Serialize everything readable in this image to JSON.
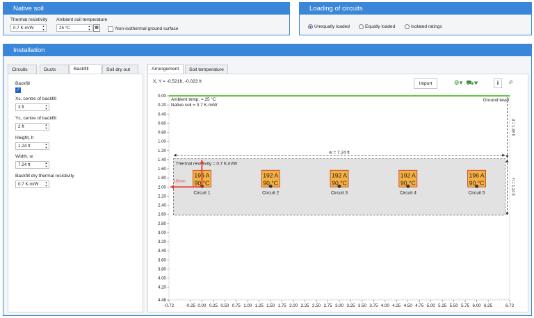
{
  "native_soil": {
    "title": "Native soil",
    "thermal_resistivity_label": "Thermal resistivity",
    "thermal_resistivity_value": "0.7 K.m/W",
    "ambient_temp_label": "Ambient soil temperature",
    "ambient_temp_value": "25 °C",
    "nonisothermal_label": "Non-isothermal ground surface",
    "nonisothermal_checked": false
  },
  "loading": {
    "title": "Loading of circuits",
    "options": [
      {
        "label": "Unequally loaded",
        "selected": true
      },
      {
        "label": "Equally loaded",
        "selected": false
      },
      {
        "label": "Isolated ratings",
        "selected": false
      }
    ]
  },
  "installation": {
    "title": "Installation",
    "left_tabs": [
      "Circuits",
      "Ducts",
      "Backfill",
      "Soil dry out"
    ],
    "left_active_tab": "Backfill",
    "backfill": {
      "backfill_label": "Backfill",
      "backfill_checked": true,
      "xc_label": "Xc, centre of backfill",
      "xc_value": "3 ft",
      "yc_label": "Yc, centre of backfill",
      "yc_value": "2 ft",
      "height_label": "Height, h",
      "height_value": "1.24 ft",
      "width_label": "Width, w",
      "width_value": "7.24 ft",
      "dry_label": "Backfill dry thermal resistivity",
      "dry_value": "0.7 K.m/W"
    },
    "right_tabs": [
      "Arrangement",
      "Soil temperature"
    ],
    "right_active_tab": "Arrangement",
    "coord_readout": "X, Y = -0.521ft, -0.023 ft",
    "import_label": "Import",
    "icons": [
      "cable-config-icon",
      "vehicle-config-icon",
      "info-icon",
      "zoom-icon"
    ]
  },
  "diagram": {
    "ground_level_label": "Ground level",
    "ambient_text": "Ambient temp. = 25 °C",
    "native_text": "Native soil = 0.7 K.m/W",
    "backfill_resistivity_text": "Thermal resistivity = 0.7 K.m/W",
    "width_dim_label": "w = 7.24 ft",
    "offset_label": "150mm",
    "right_dim_top": "d = 1.38 ft",
    "right_dim_bottom": "h = 1.24 ft",
    "circuits": [
      {
        "name": "Circuit 1",
        "current": "196 A",
        "temp": "90 °C",
        "x": 0.0
      },
      {
        "name": "Circuit 2",
        "current": "192 A",
        "temp": "90 °C",
        "x": 1.5
      },
      {
        "name": "Circuit 3",
        "current": "192 A",
        "temp": "90 °C",
        "x": 3.0
      },
      {
        "name": "Circuit 4",
        "current": "192 A",
        "temp": "90 °C",
        "x": 4.5
      },
      {
        "name": "Circuit 5",
        "current": "196 A",
        "temp": "90 °C",
        "x": 6.0
      }
    ],
    "circuit_depth": 2.0,
    "backfill_x": [
      -0.62,
      6.62
    ],
    "backfill_y": [
      1.38,
      2.62
    ],
    "x_ticks": [
      "-0.72",
      "-0.25",
      "0.00",
      "0.25",
      "0.50",
      "0.75",
      "1.00",
      "1.25",
      "1.50",
      "1.75",
      "2.00",
      "2.25",
      "2.50",
      "2.75",
      "3.00",
      "3.25",
      "3.50",
      "3.75",
      "4.00",
      "4.25",
      "4.50",
      "4.75",
      "5.00",
      "5.25",
      "5.50",
      "5.75",
      "6.00",
      "6.25",
      "6.72"
    ],
    "y_ticks": [
      "0.00",
      "0.20",
      "0.40",
      "0.60",
      "0.80",
      "1.00",
      "1.20",
      "1.40",
      "1.60",
      "1.80",
      "2.00",
      "2.20",
      "2.40",
      "2.60",
      "2.80",
      "3.00",
      "3.20",
      "3.40",
      "3.60",
      "3.80",
      "4.00",
      "4.20",
      "4.48"
    ],
    "x_range": [
      -0.72,
      6.72
    ],
    "y_range": [
      0.0,
      4.48
    ],
    "colors": {
      "accent": "#3a86d8",
      "ground_line": "#6cc24a",
      "circuit_fill": "#f5b041",
      "circuit_border": "#c0392b",
      "arrow": "#e53935",
      "backfill_fill": "#e2e2e2"
    }
  }
}
